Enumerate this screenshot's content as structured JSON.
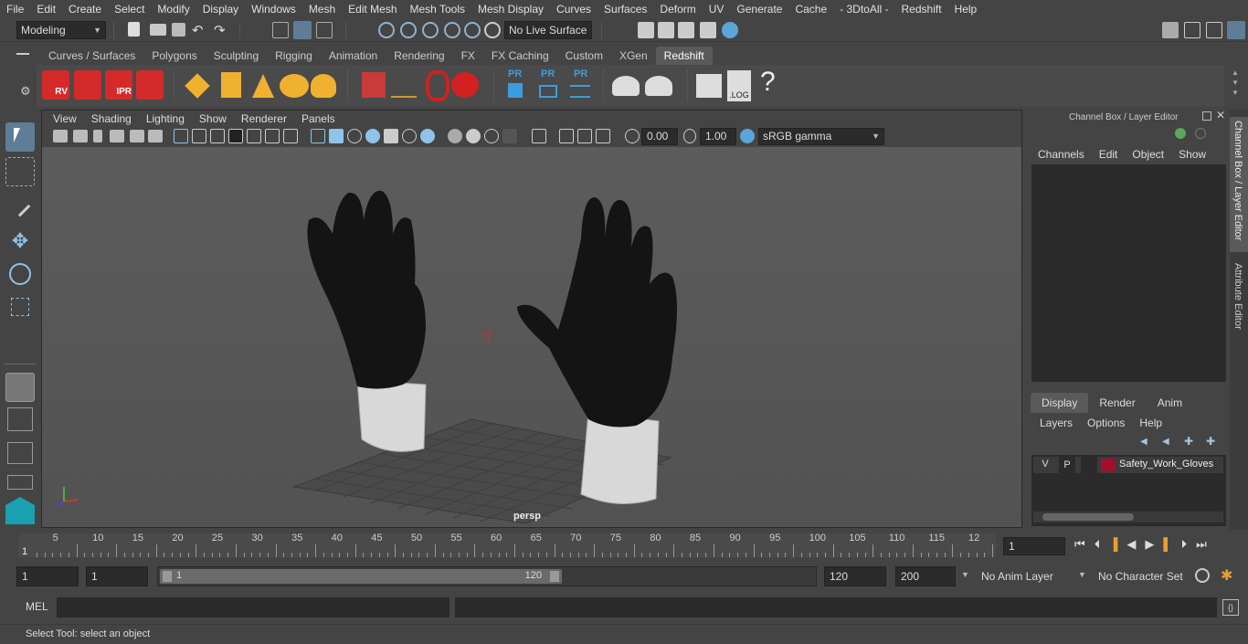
{
  "menubar": [
    "File",
    "Edit",
    "Create",
    "Select",
    "Modify",
    "Display",
    "Windows",
    "Mesh",
    "Edit Mesh",
    "Mesh Tools",
    "Mesh Display",
    "Curves",
    "Surfaces",
    "Deform",
    "UV",
    "Generate",
    "Cache",
    "- 3DtoAll -",
    "Redshift",
    "Help"
  ],
  "status": {
    "mode": "Modeling",
    "live_surface": "No Live Surface"
  },
  "shelf_tabs": [
    "Curves / Surfaces",
    "Polygons",
    "Sculpting",
    "Rigging",
    "Animation",
    "Rendering",
    "FX",
    "FX Caching",
    "Custom",
    "XGen",
    "Redshift"
  ],
  "active_shelf_tab": "Redshift",
  "shelf_icons": {
    "rv": "RV",
    "ipr": "IPR",
    "pr": "PR",
    "log": ".LOG",
    "help": "?"
  },
  "viewport": {
    "menu": [
      "View",
      "Shading",
      "Lighting",
      "Show",
      "Renderer",
      "Panels"
    ],
    "exposure": "0.00",
    "gamma": "1.00",
    "color_space": "sRGB gamma",
    "camera": "persp"
  },
  "channel_box": {
    "title": "Channel Box / Layer Editor",
    "menu": [
      "Channels",
      "Edit",
      "Object",
      "Show"
    ]
  },
  "layer_editor": {
    "tabs": [
      "Display",
      "Render",
      "Anim"
    ],
    "active_tab": "Display",
    "menu": [
      "Layers",
      "Options",
      "Help"
    ],
    "layer": {
      "v": "V",
      "p": "P",
      "name": "Safety_Work_Gloves",
      "color": "#a0102a"
    }
  },
  "side_tabs": [
    "Channel Box / Layer Editor",
    "Attribute Editor"
  ],
  "timeline": {
    "ticks": [
      "5",
      "10",
      "15",
      "20",
      "25",
      "30",
      "35",
      "40",
      "45",
      "50",
      "55",
      "60",
      "65",
      "70",
      "75",
      "80",
      "85",
      "90",
      "95",
      "100",
      "105",
      "110",
      "115",
      "12"
    ],
    "start_marker": "1",
    "current_frame": "1"
  },
  "range": {
    "start": "1",
    "inner_start": "1",
    "slider_start": "1",
    "slider_end": "120",
    "end": "120",
    "max": "200",
    "anim_layer": "No Anim Layer",
    "char_set": "No Character Set"
  },
  "cmd": {
    "lang": "MEL"
  },
  "help_line": "Select Tool: select an object"
}
